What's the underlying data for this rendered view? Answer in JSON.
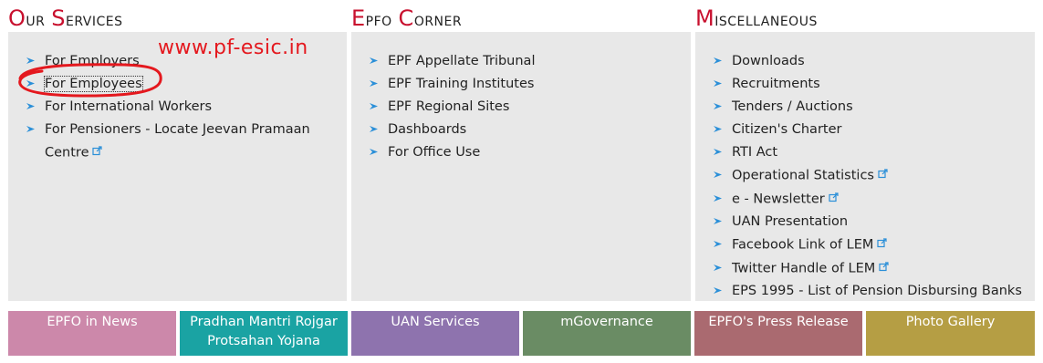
{
  "services": {
    "heading": "Our Services",
    "items": [
      {
        "label": "For Employers",
        "external": false
      },
      {
        "label": "For Employees",
        "external": false
      },
      {
        "label": "For International Workers",
        "external": false
      },
      {
        "label": "For Pensioners - Locate Jeevan Pramaan",
        "label2": "Centre",
        "external": true
      }
    ]
  },
  "corner": {
    "heading": "Epfo Corner",
    "items": [
      {
        "label": "EPF Appellate Tribunal",
        "external": false
      },
      {
        "label": "EPF Training Institutes",
        "external": false
      },
      {
        "label": "EPF Regional Sites",
        "external": false
      },
      {
        "label": "Dashboards",
        "external": false
      },
      {
        "label": "For Office Use",
        "external": false
      }
    ]
  },
  "misc": {
    "heading": "Miscellaneous",
    "items": [
      {
        "label": "Downloads",
        "external": false
      },
      {
        "label": "Recruitments",
        "external": false
      },
      {
        "label": "Tenders / Auctions",
        "external": false
      },
      {
        "label": "Citizen's Charter",
        "external": false
      },
      {
        "label": "RTI Act",
        "external": false
      },
      {
        "label": "Operational Statistics",
        "external": true
      },
      {
        "label": "e - Newsletter",
        "external": true
      },
      {
        "label": "UAN Presentation",
        "external": false
      },
      {
        "label": "Facebook Link of LEM",
        "external": true
      },
      {
        "label": "Twitter Handle of LEM",
        "external": true
      },
      {
        "label": "EPS 1995 - List of Pension Disbursing Banks",
        "external": false
      }
    ]
  },
  "tiles": [
    {
      "label": "EPFO in News",
      "color": "#cc88aa"
    },
    {
      "label": "Pradhan Mantri Rojgar Protsahan Yojana",
      "color": "#1aa3a3"
    },
    {
      "label": "UAN Services",
      "color": "#8e73ae"
    },
    {
      "label": "mGovernance",
      "color": "#6a8c64"
    },
    {
      "label": "EPFO's Press Release",
      "color": "#aa6a70"
    },
    {
      "label": "Photo Gallery",
      "color": "#b59e44"
    }
  ],
  "watermark": "www.pf-esic.in",
  "colors": {
    "accent": "#c8102e",
    "panel": "#e8e8e8",
    "arrow": "#2a8fd8",
    "annotation": "#e4181e"
  }
}
